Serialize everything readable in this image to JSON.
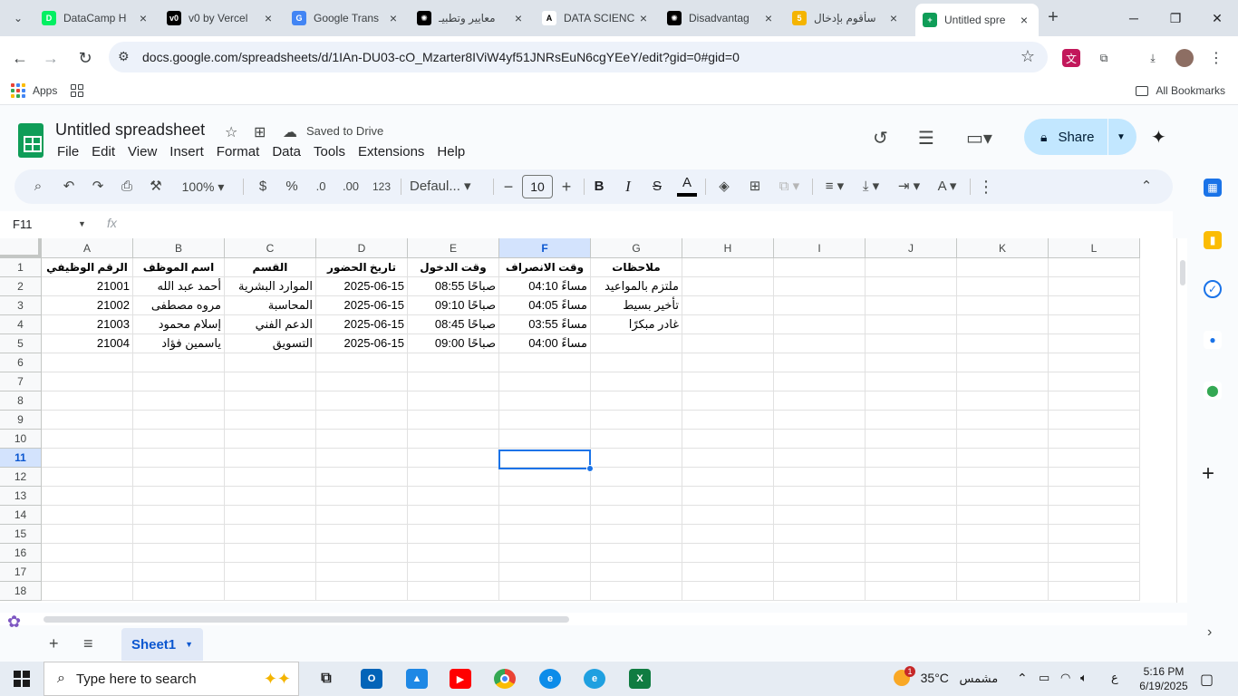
{
  "browser": {
    "tabs": [
      {
        "title": "DataCamp H",
        "icon": "datacamp-icon",
        "color": "#03ef62",
        "glyph": "D"
      },
      {
        "title": "v0 by Vercel",
        "icon": "v0-icon",
        "color": "#000000",
        "glyph": "v0"
      },
      {
        "title": "Google Trans",
        "icon": "google-translate-icon",
        "color": "#4285f4",
        "glyph": "G"
      },
      {
        "title": "معايير وتطبيـ",
        "icon": "openai-icon",
        "color": "#000000",
        "glyph": "✺"
      },
      {
        "title": "DATA SCIENC",
        "icon": "anthropic-icon",
        "color": "#ffffff",
        "glyph": "A"
      },
      {
        "title": "Disadvantag",
        "icon": "chatgpt-icon",
        "color": "#000000",
        "glyph": "✺"
      },
      {
        "title": "سأقوم بإدخال",
        "icon": "number-five-icon",
        "color": "#f4b400",
        "glyph": "5"
      },
      {
        "title": "Untitled spre",
        "icon": "sheets-icon",
        "color": "#0f9d58",
        "glyph": "+",
        "active": true
      }
    ],
    "url": "docs.google.com/spreadsheets/d/1IAn-DU03-cO_Mzarter8IViW4yf51JNRsEuN6cgYEeY/edit?gid=0#gid=0",
    "bookmarks": {
      "apps_label": "Apps",
      "all_label": "All Bookmarks"
    }
  },
  "sheets": {
    "title": "Untitled spreadsheet",
    "saved_status": "Saved to Drive",
    "menu": [
      "File",
      "Edit",
      "View",
      "Insert",
      "Format",
      "Data",
      "Tools",
      "Extensions",
      "Help"
    ],
    "share_label": "Share",
    "toolbar": {
      "zoom": "100%",
      "currency": "$",
      "percent": "%",
      "dec_decrease": ".0",
      "dec_increase": ".00",
      "number_format": "123",
      "font": "Defaul...",
      "font_size": "10"
    },
    "name_box": "F11",
    "fx": "fx",
    "columns": [
      "A",
      "B",
      "C",
      "D",
      "E",
      "F",
      "G",
      "H",
      "I",
      "J",
      "K",
      "L"
    ],
    "selected_column": "F",
    "selected_row": "11",
    "rows": [
      "1",
      "2",
      "3",
      "4",
      "5",
      "6",
      "7",
      "8",
      "9",
      "10",
      "11",
      "12",
      "13",
      "14",
      "15",
      "16",
      "17",
      "18"
    ],
    "data": [
      [
        "الرقم الوظيفي",
        "اسم الموظف",
        "القسم",
        "تاريخ الحضور",
        "وقت الدخول",
        "وقت الانصراف",
        "ملاحظات"
      ],
      [
        "21001",
        "أحمد عبد الله",
        "الموارد البشرية",
        "2025-06-15",
        "08:55 صباحًا",
        "04:10 مساءً",
        "ملتزم بالمواعيد"
      ],
      [
        "21002",
        "مروه مصطفى",
        "المحاسبة",
        "2025-06-15",
        "09:10 صباحًا",
        "04:05 مساءً",
        "تأخير بسيط"
      ],
      [
        "21003",
        "إسلام محمود",
        "الدعم الفني",
        "2025-06-15",
        "08:45 صباحًا",
        "03:55 مساءً",
        "غادر مبكرًا"
      ],
      [
        "21004",
        "ياسمين فؤاد",
        "التسويق",
        "2025-06-15",
        "09:00 صباحًا",
        "04:00 مساءً",
        ""
      ]
    ],
    "sheet_tab": "Sheet1"
  },
  "taskbar": {
    "search_placeholder": "Type here to search",
    "weather_temp": "35°C",
    "weather_desc": "مشمس",
    "weather_badge": "1",
    "lang": "ع",
    "time": "5:16 PM",
    "date": "6/19/2025"
  }
}
